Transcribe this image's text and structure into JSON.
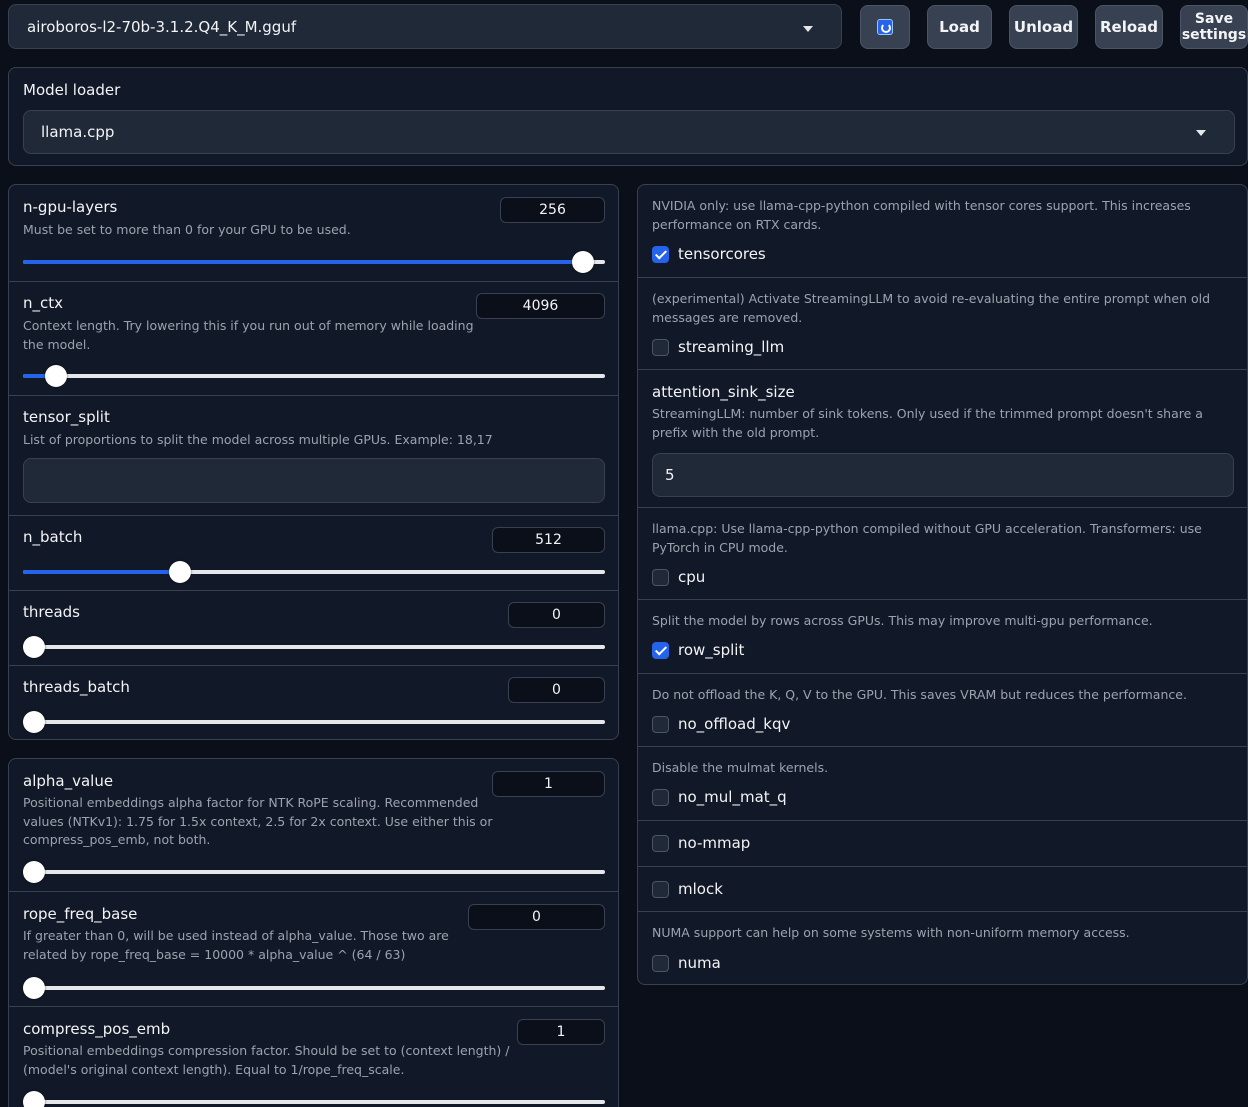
{
  "topbar": {
    "model_value": "airoboros-l2-70b-3.1.2.Q4_K_M.gguf",
    "load": "Load",
    "unload": "Unload",
    "reload": "Reload",
    "save_line1": "Save",
    "save_line2": "settings"
  },
  "loader": {
    "label": "Model loader",
    "value": "llama.cpp"
  },
  "gpu_panel": {
    "n_gpu_layers": {
      "label": "n-gpu-layers",
      "desc": "Must be set to more than 0 for your GPU to be used.",
      "value": "256",
      "fraction": 0.98
    },
    "n_ctx": {
      "label": "n_ctx",
      "desc_1": "Context length. Try lowering this if you run out of memory while loading",
      "desc_2": "the model.",
      "value": "4096",
      "fraction": 0.04
    },
    "tensor_split": {
      "label": "tensor_split",
      "desc": "List of proportions to split the model across multiple GPUs. Example: 18,17",
      "value": ""
    },
    "n_batch": {
      "label": "n_batch",
      "value": "512",
      "fraction": 0.26
    },
    "threads": {
      "label": "threads",
      "value": "0",
      "fraction": 0.0
    },
    "threads_batch": {
      "label": "threads_batch",
      "value": "0",
      "fraction": 0.0
    }
  },
  "rope_panel": {
    "alpha_value": {
      "label": "alpha_value",
      "desc_1": "Positional embeddings alpha factor for NTK RoPE scaling. Recommended",
      "desc_2": "values (NTKv1): 1.75 for 1.5x context, 2.5 for 2x context. Use either this or",
      "desc_3": "compress_pos_emb, not both.",
      "value": "1",
      "fraction": 0.0
    },
    "rope_freq_base": {
      "label": "rope_freq_base",
      "desc_1": "If greater than 0, will be used instead of alpha_value. Those two are",
      "desc_2": "related by rope_freq_base = 10000 * alpha_value ^ (64 / 63)",
      "value": "0",
      "fraction": 0.0
    },
    "compress_pos_emb": {
      "label": "compress_pos_emb",
      "desc_1": "Positional embeddings compression factor. Should be set to (context length) /",
      "desc_2": "(model's original context length). Equal to 1/rope_freq_scale.",
      "value": "1",
      "fraction": 0.0
    }
  },
  "options_panel": {
    "tensorcores": {
      "desc_1": "NVIDIA only: use llama-cpp-python compiled with tensor cores support. This increases",
      "desc_2": "performance on RTX cards.",
      "label": "tensorcores",
      "checked": true
    },
    "streaming_llm": {
      "desc_1": "(experimental) Activate StreamingLLM to avoid re-evaluating the entire prompt when old",
      "desc_2": "messages are removed.",
      "label": "streaming_llm",
      "checked": false
    },
    "attention_sink_size": {
      "label": "attention_sink_size",
      "desc_1": "StreamingLLM: number of sink tokens. Only used if the trimmed prompt doesn't share a",
      "desc_2": "prefix with the old prompt.",
      "value": "5"
    },
    "cpu": {
      "desc_1": "llama.cpp: Use llama-cpp-python compiled without GPU acceleration. Transformers: use",
      "desc_2": "PyTorch in CPU mode.",
      "label": "cpu",
      "checked": false
    },
    "row_split": {
      "desc": "Split the model by rows across GPUs. This may improve multi-gpu performance.",
      "label": "row_split",
      "checked": true
    },
    "no_offload_kqv": {
      "desc": "Do not offload the K, Q, V to the GPU. This saves VRAM but reduces the performance.",
      "label": "no_offload_kqv",
      "checked": false
    },
    "no_mul_mat_q": {
      "desc": "Disable the mulmat kernels.",
      "label": "no_mul_mat_q",
      "checked": false
    },
    "no_mmap": {
      "label": "no-mmap",
      "checked": false
    },
    "mlock": {
      "label": "mlock",
      "checked": false
    },
    "numa": {
      "desc": "NUMA support can help on some systems with non-uniform memory access.",
      "label": "numa",
      "checked": false
    }
  }
}
